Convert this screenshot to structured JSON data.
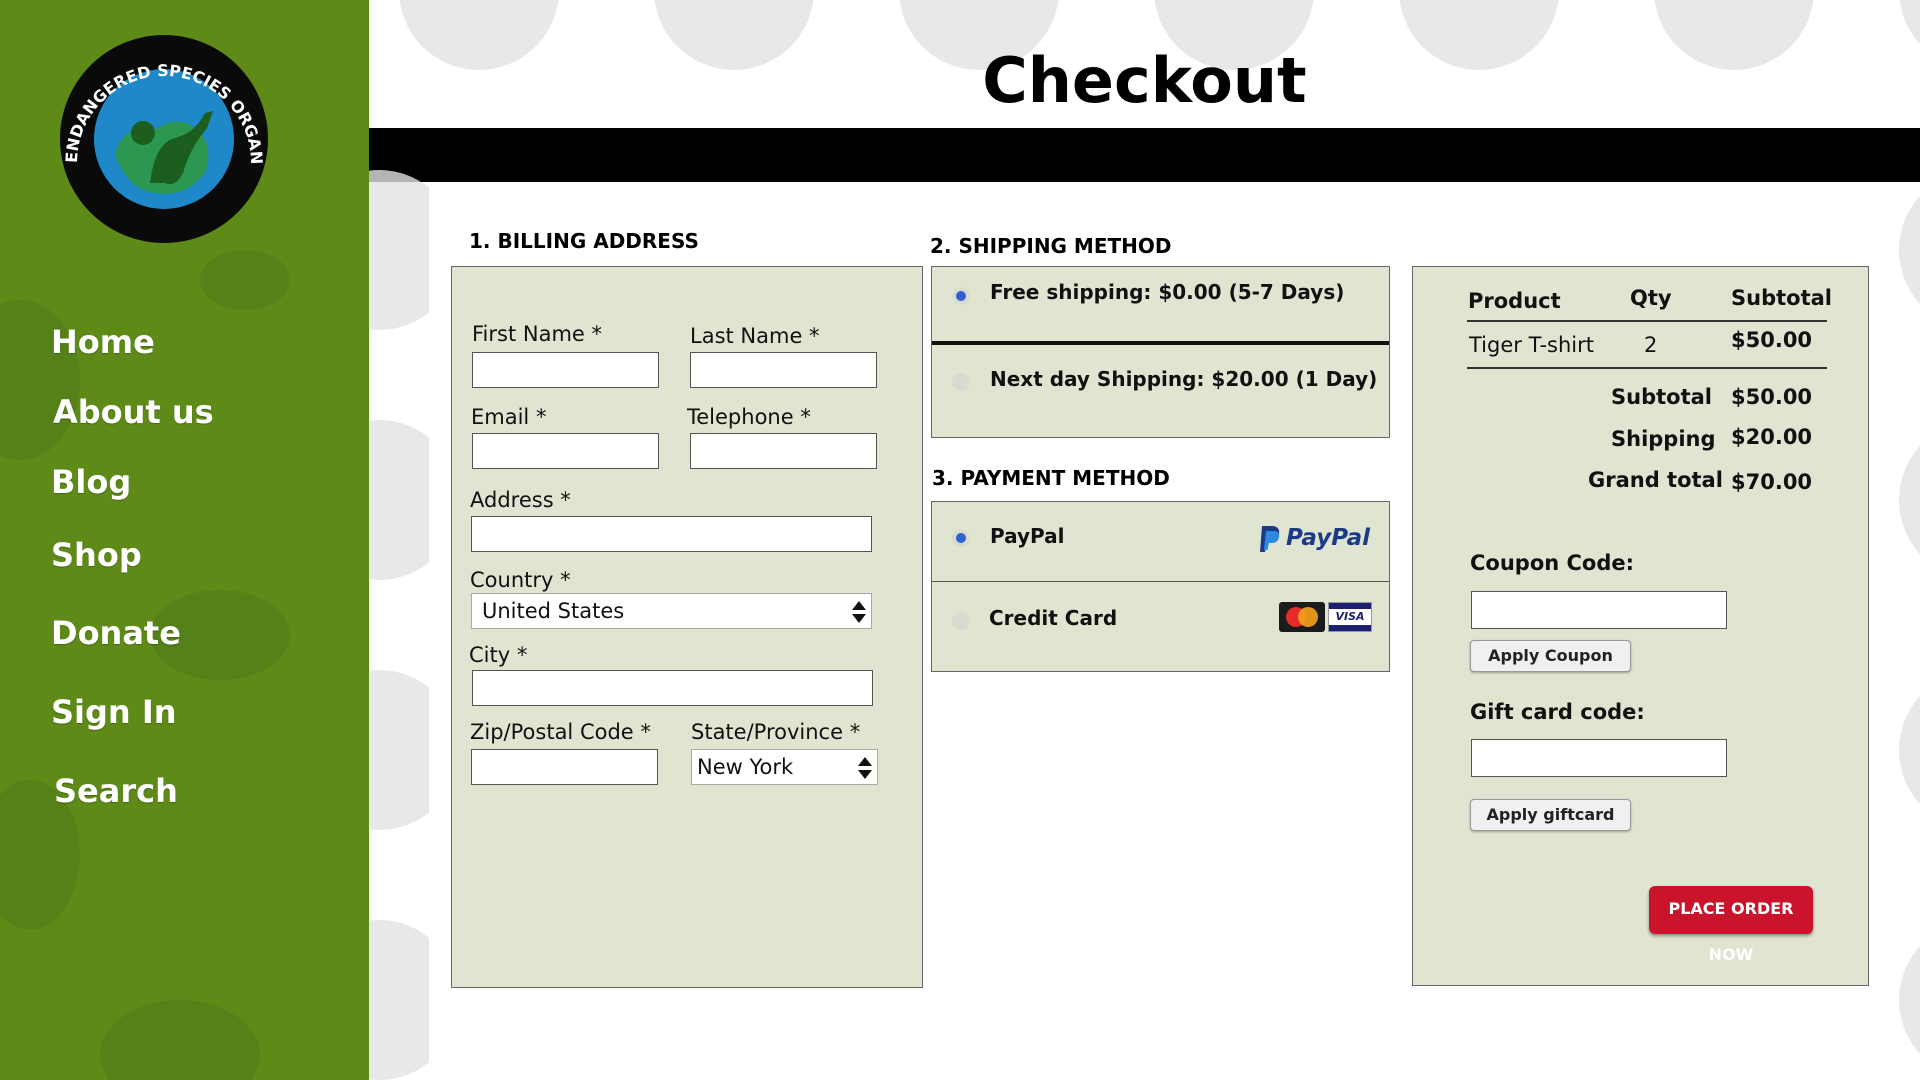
{
  "logo": {
    "text": "ENDANGERED SPECIES ORGANIZATION"
  },
  "nav": {
    "items": [
      "Home",
      "About us",
      "Blog",
      "Shop",
      "Donate",
      "Sign In",
      "Search"
    ]
  },
  "page": {
    "title": "Checkout"
  },
  "billing": {
    "section_title": "1. BILLING ADDRESS",
    "first_name_label": "First Name *",
    "last_name_label": "Last Name *",
    "email_label": "Email *",
    "telephone_label": "Telephone *",
    "address_label": "Address *",
    "country_label": "Country *",
    "country_value": "United States",
    "city_label": "City *",
    "zip_label": "Zip/Postal Code *",
    "state_label": "State/Province *",
    "state_value": "New York"
  },
  "shipping": {
    "section_title": "2. SHIPPING METHOD",
    "options": [
      {
        "label": "Free shipping: $0.00 (5-7 Days)",
        "selected": true
      },
      {
        "label": "Next day Shipping: $20.00 (1 Day)",
        "selected": false
      }
    ]
  },
  "payment": {
    "section_title": "3. PAYMENT METHOD",
    "options": [
      {
        "label": "PayPal",
        "selected": true,
        "logo_text": "PayPal"
      },
      {
        "label": "Credit Card",
        "selected": false
      }
    ],
    "card_logo": "VISA"
  },
  "summary": {
    "headers": {
      "product": "Product",
      "qty": "Qty",
      "subtotal": "Subtotal"
    },
    "items": [
      {
        "product": "Tiger T-shirt",
        "qty": "2",
        "subtotal": "$50.00"
      }
    ],
    "totals": [
      {
        "label": "Subtotal",
        "value": "$50.00"
      },
      {
        "label": "Shipping",
        "value": "$20.00"
      },
      {
        "label": "Grand total",
        "value": "$70.00"
      }
    ],
    "coupon_label": "Coupon Code:",
    "apply_coupon": "Apply Coupon",
    "giftcard_label": "Gift card code:",
    "apply_giftcard": "Apply giftcard",
    "place_order": "PLACE ORDER NOW"
  },
  "colors": {
    "sidebar": "#5e8a18",
    "panel": "#e0e5d2",
    "place_order": "#c9142b",
    "radio_selected": "#2f5fd0"
  }
}
